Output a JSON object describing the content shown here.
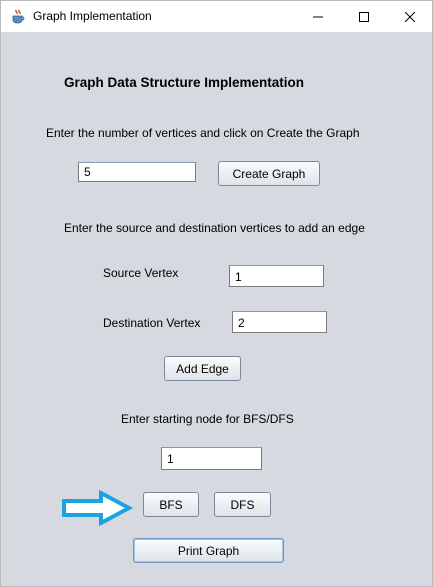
{
  "window": {
    "title": "Graph Implementation"
  },
  "heading": "Graph Data Structure Implementation",
  "vertices": {
    "prompt": "Enter the number of vertices and click on Create the Graph",
    "value": "5",
    "create_label": "Create Graph"
  },
  "edges": {
    "prompt": "Enter the source and destination vertices to add an edge",
    "source_label": "Source Vertex",
    "source_value": "1",
    "dest_label": "Destination Vertex",
    "dest_value": "2",
    "add_label": "Add Edge"
  },
  "traversal": {
    "prompt": "Enter starting node for BFS/DFS",
    "start_value": "1",
    "bfs_label": "BFS",
    "dfs_label": "DFS",
    "print_label": "Print Graph"
  },
  "colors": {
    "window_bg": "#d6d9df",
    "annotation_arrow": "#1aa3e0"
  },
  "icons": {
    "app": "java-coffee-cup-icon",
    "minimize": "minimize-icon",
    "maximize": "maximize-icon",
    "close": "close-icon",
    "annotation": "right-arrow-icon"
  }
}
